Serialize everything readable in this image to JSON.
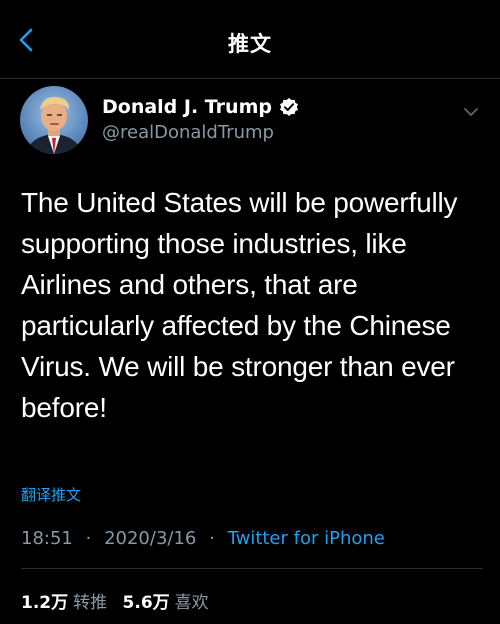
{
  "nav": {
    "title": "推文",
    "back_icon": "chevron-left-icon",
    "accent_color": "#1da1f2"
  },
  "author": {
    "name": "Donald J. Trump",
    "handle": "@realDonaldTrump",
    "verified": true,
    "verified_icon": "verified-badge-icon",
    "menu_icon": "chevron-down-icon"
  },
  "tweet": {
    "text": "The United States will be powerfully supporting those industries, like Airlines and others, that are particularly affected by the Chinese Virus. We will be stronger than ever before!",
    "translate_label": "翻译推文"
  },
  "meta": {
    "time": "18:51",
    "date": "2020/3/16",
    "separator": "·",
    "source": "Twitter for iPhone"
  },
  "stats": {
    "retweets_count": "1.2万",
    "retweets_label": "转推",
    "likes_count": "5.6万",
    "likes_label": "喜欢"
  }
}
